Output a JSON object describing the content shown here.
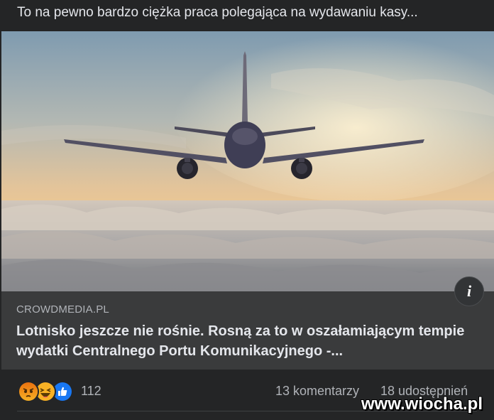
{
  "post": {
    "text": "To na pewno bardzo ciężka praca polegająca na wydawaniu kasy..."
  },
  "link_preview": {
    "domain": "CROWDMEDIA.PL",
    "headline": "Lotnisko jeszcze nie rośnie. Rosną za to w oszałamiającym tempie wydatki Centralnego Portu Komunikacyjnego -...",
    "info_icon": "info-icon"
  },
  "reactions": {
    "icons": [
      "angry-icon",
      "haha-icon",
      "like-icon"
    ],
    "count": "112",
    "comments": "13 komentarzy",
    "shares": "18 udostępnień"
  },
  "watermark": {
    "text": "www.wiocha.pl"
  },
  "colors": {
    "background": "#242526",
    "link_box": "#3a3b3c",
    "text_primary": "#e4e6eb",
    "text_secondary": "#b0b3b8",
    "like_blue": "#1877f2",
    "haha_yellow": "#f7b125",
    "angry_orange": "#e9710f"
  }
}
